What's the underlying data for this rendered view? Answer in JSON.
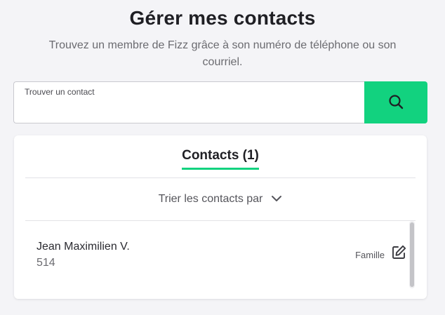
{
  "header": {
    "title": "Gérer mes contacts",
    "subtitle": "Trouvez un membre de Fizz grâce à son numéro de téléphone ou son courriel."
  },
  "search": {
    "label": "Trouver un contact",
    "value": "",
    "button_icon": "search-icon"
  },
  "tabs": [
    {
      "label": "Contacts (1)",
      "active": true
    }
  ],
  "sort": {
    "label": "Trier les contacts par",
    "icon": "chevron-down-icon"
  },
  "contacts": [
    {
      "name": "Jean Maximilien V.",
      "number": "514",
      "relation": "Famille",
      "edit_icon": "edit-icon"
    }
  ],
  "colors": {
    "accent": "#12d27f",
    "background": "#f4f4f7",
    "text": "#1f1f24"
  }
}
